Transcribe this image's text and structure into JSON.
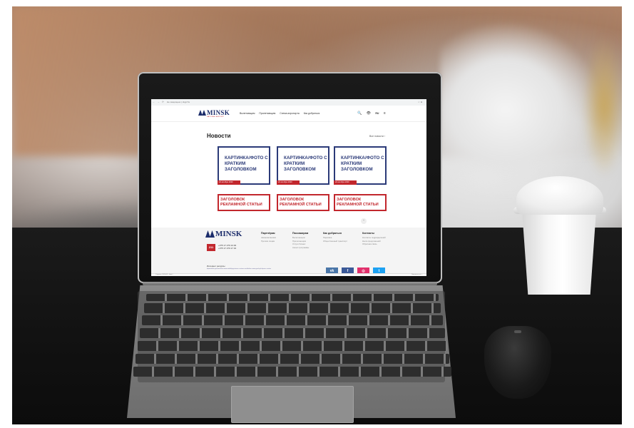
{
  "browser": {
    "url": "Не защищено | dsgn7w",
    "nav_glyphs": "← → ⟳",
    "right_glyphs": "☆ ●"
  },
  "site": {
    "logo": "MINSK",
    "logo_sub": "NATIONAL AIRPORT",
    "nav": [
      "Вылетающим",
      "Прилетающим",
      "Схема аэропорта",
      "Как добраться"
    ],
    "header_icons": [
      "🔍",
      "👁",
      "RU",
      "≡"
    ],
    "news_title": "Новости",
    "all_news": "Все новости  ›",
    "cards": [
      {
        "text": "КАРТИНКА/ФОТО С КРАТКИМ ЗАГОЛОВКОМ",
        "date": "22 октября 2020"
      },
      {
        "text": "КАРТИНКА/ФОТО С КРАТКИМ ЗАГОЛОВКОМ",
        "date": "22 октября 2020"
      },
      {
        "text": "КАРТИНКА/ФОТО С КРАТКИМ ЗАГОЛОВКОМ",
        "date": "22 октября 2020"
      }
    ],
    "ads": [
      "ЗАГОЛОВОК РЕКЛАМНОЙ СТАТЬИ",
      "ЗАГОЛОВОК РЕКЛАМНОЙ СТАТЬИ",
      "ЗАГОЛОВОК РЕКЛАМНОЙ СТАТЬИ"
    ],
    "up_arrow": "⌃"
  },
  "footer": {
    "logo": "MINSK",
    "phone_code": "211",
    "phones": [
      "+375 17 279 13 00",
      "+375 17 279 17 32"
    ],
    "columns": [
      {
        "heading": "Партнёрам",
        "items": [
          "Авиакомпаниям",
          "Прочим лицам"
        ]
      },
      {
        "heading": "Пассажирам",
        "items": [
          "Вылетающим",
          "Прилетающим",
          "Услуги бизнес",
          "Анонс программы"
        ]
      },
      {
        "heading": "Как добраться",
        "items": [
          "Парковка",
          "Общественный транспорт"
        ]
      },
      {
        "heading": "Контакты",
        "items": [
          "Контакты подразделений",
          "Книга предложений",
          "Обратная связь"
        ]
      }
    ],
    "useful_title": "Интернет ресурсы",
    "useful_links": "dipnetwork.government   www.mobilitysystems.custom.com/belize   www.gov.by/ru/press-center",
    "social": [
      {
        "label": "vk",
        "color": "#4a76a8"
      },
      {
        "label": "f",
        "color": "#3b5998"
      },
      {
        "label": "◎",
        "color": "#e1306c"
      },
      {
        "label": "t",
        "color": "#1da1f2"
      }
    ],
    "status_left": "Открыть 2020-05...html  ^",
    "status_right": "Показать все  ×"
  }
}
